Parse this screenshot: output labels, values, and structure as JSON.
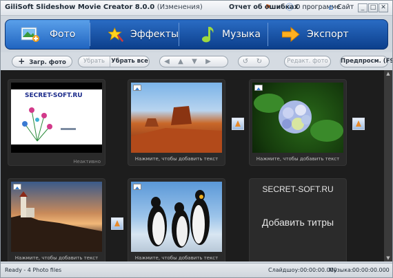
{
  "window": {
    "title": "GiliSoft Slideshow Movie Creator 8.0.0",
    "title_status": "(Изменения)",
    "links": {
      "report": "Отчет об ошибках",
      "about": "О программе",
      "site": "Сайт"
    },
    "controls": {
      "minimize": "_",
      "maximize": "□",
      "close": "✕"
    }
  },
  "tabs": [
    {
      "label": "Фото",
      "icon": "photo-icon",
      "active": true
    },
    {
      "label": "Эффекты",
      "icon": "effects-star-icon",
      "active": false
    },
    {
      "label": "Музыка",
      "icon": "music-note-icon",
      "active": false
    },
    {
      "label": "Экспорт",
      "icon": "export-arrow-icon",
      "active": false
    }
  ],
  "toolbar": {
    "add_photo": "Загр. фото",
    "remove": "Убрать",
    "remove_all": "Убрать все",
    "edit_photo": "Редакт. фото",
    "preview": "Предпросм. (F9)"
  },
  "slides": [
    {
      "watermark": "SECRET-SOFT.RU",
      "caption": "",
      "inactive": "Неактивно"
    },
    {
      "caption": "Нажмите, чтобы добавить текст"
    },
    {
      "caption": "Нажмите, чтобы добавить текст"
    },
    {
      "caption": "Нажмите, чтобы добавить текст"
    },
    {
      "caption": "Нажмите, чтобы добавить текст"
    }
  ],
  "title_card": {
    "line1": "SECRET-SOFT.RU",
    "line2": "Добавить титры"
  },
  "status": {
    "ready": "Ready - 4 Photo files",
    "slideshow": "Слайдшоу:00:00:00.000",
    "music_label": "Музыка:",
    "music_time": "00:00:00.000"
  },
  "colors": {
    "accent": "#1f5fb8",
    "workspace": "#1d1d1d"
  }
}
